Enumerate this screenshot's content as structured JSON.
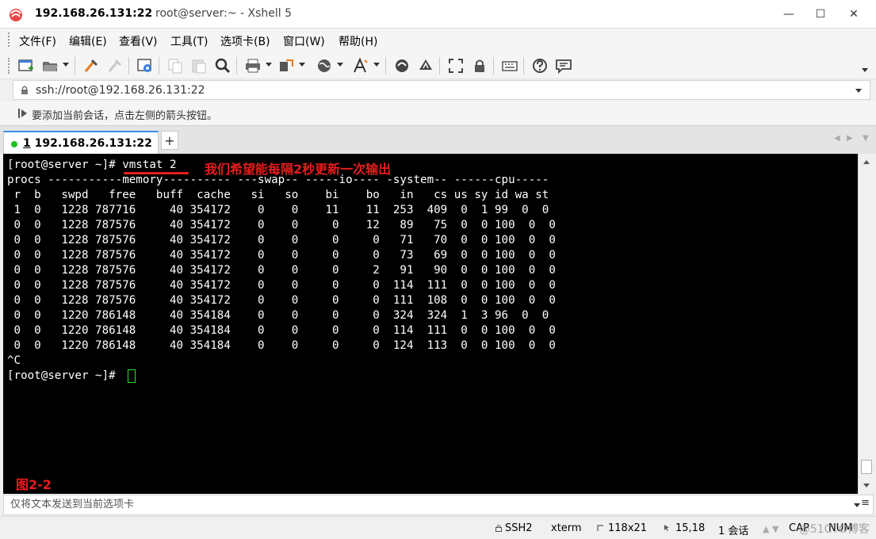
{
  "window": {
    "host": "192.168.26.131:22",
    "subtitle": "root@server:~ - Xshell 5",
    "minimize_glyph": "—",
    "maximize_glyph": "☐",
    "close_glyph": "✕"
  },
  "menu": [
    "文件(F)",
    "编辑(E)",
    "查看(V)",
    "工具(T)",
    "选项卡(B)",
    "窗口(W)",
    "帮助(H)"
  ],
  "address": {
    "value": "ssh://root@192.168.26.131:22"
  },
  "hint": {
    "text": "要添加当前会话，点击左侧的箭头按钮。"
  },
  "tabs": [
    {
      "number": "1",
      "label": " 192.168.26.131:22",
      "active": true
    }
  ],
  "tab_add": "+",
  "terminal": {
    "prompt1": "[root@server ~]# ",
    "command": "vmstat 2",
    "annotation": "我们希望能每隔2秒更新一次输出",
    "figure_label": "图2-2",
    "lines": [
      "procs -----------memory---------- ---swap-- -----io---- -system-- ------cpu-----",
      " r  b   swpd   free   buff  cache   si   so    bi    bo   in   cs us sy id wa st",
      " 1  0   1228 787716     40 354172    0    0    11    11  253  409  0  1 99  0  0",
      " 0  0   1228 787576     40 354172    0    0     0    12   89   75  0  0 100  0  0",
      " 0  0   1228 787576     40 354172    0    0     0     0   71   70  0  0 100  0  0",
      " 0  0   1228 787576     40 354172    0    0     0     0   73   69  0  0 100  0  0",
      " 0  0   1228 787576     40 354172    0    0     0     2   91   90  0  0 100  0  0",
      " 0  0   1228 787576     40 354172    0    0     0     0  114  111  0  0 100  0  0",
      " 0  0   1228 787576     40 354172    0    0     0     0  111  108  0  0 100  0  0",
      " 0  0   1220 786148     40 354184    0    0     0     0  324  324  1  3 96  0  0",
      " 0  0   1220 786148     40 354184    0    0     0     0  114  111  0  0 100  0  0",
      " 0  0   1220 786148     40 354184    0    0     0     0  124  113  0  0 100  0  0",
      "^C"
    ],
    "prompt2": "[root@server ~]# "
  },
  "compose": {
    "placeholder": "仅将文本发送到当前选项卡",
    "menu_glyph": "≡"
  },
  "status": {
    "protocol": "SSH2",
    "term": "xterm",
    "size": "118x21",
    "cursor_pos": "15,18",
    "sessions": "1 会话",
    "caps": "CAP",
    "num": "NUM",
    "watermark": "@51CTO博客"
  },
  "colors": {
    "terminal_bg": "#000000",
    "terminal_fg": "#ffffff",
    "annotation": "#e81d1d",
    "cursor": "#2fe02f",
    "tab_dot": "#1cc21c"
  }
}
